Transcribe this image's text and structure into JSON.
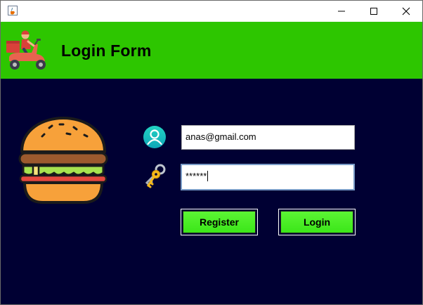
{
  "window": {
    "app_icon": "java-cup-icon",
    "controls": [
      "minimize-icon",
      "maximize-icon",
      "close-icon"
    ]
  },
  "header": {
    "title": "Login Form",
    "logo_icon": "delivery-scooter-icon",
    "background_color": "#2dc600"
  },
  "main": {
    "background_color": "#000033",
    "illustration_icon": "burger-icon",
    "email": {
      "icon": "user-icon",
      "value": "anas@gmail.com"
    },
    "password": {
      "icon": "keys-icon",
      "value": "******"
    },
    "buttons": {
      "register_label": "Register",
      "login_label": "Login",
      "color": "#3be619"
    }
  }
}
